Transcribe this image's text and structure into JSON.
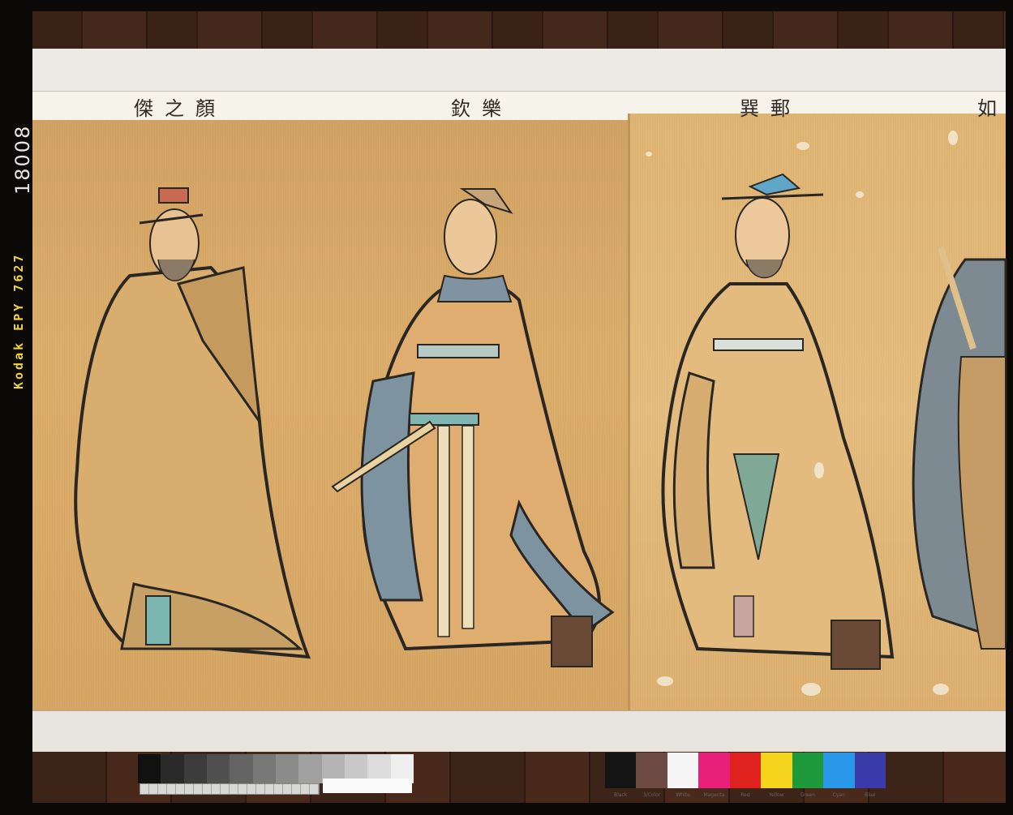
{
  "scroll": {
    "figure_labels": [
      "傑之顏",
      "欽樂",
      "巽郵",
      "如"
    ]
  },
  "film_border": {
    "edge_text": "Kodak EPY 7627",
    "frame_number": "18008"
  },
  "color_chart": {
    "patches": [
      {
        "label": "Black",
        "color": "#141414"
      },
      {
        "label": "3/Color",
        "color": "#6e4a44"
      },
      {
        "label": "White",
        "color": "#f5f5f5"
      },
      {
        "label": "Magenta",
        "color": "#e8207a"
      },
      {
        "label": "Red",
        "color": "#e0221e"
      },
      {
        "label": "Yellow",
        "color": "#f4d41c"
      },
      {
        "label": "Green",
        "color": "#1e9a3c"
      },
      {
        "label": "Cyan",
        "color": "#2a98e8"
      },
      {
        "label": "Blue",
        "color": "#3a3aa8"
      }
    ]
  },
  "gray_scale": [
    "#111111",
    "#2a2a2a",
    "#3c3c3c",
    "#505050",
    "#646464",
    "#787878",
    "#8c8c8c",
    "#a0a0a0",
    "#b4b4b4",
    "#c8c8c8",
    "#dcdcdc",
    "#eeeeee"
  ]
}
